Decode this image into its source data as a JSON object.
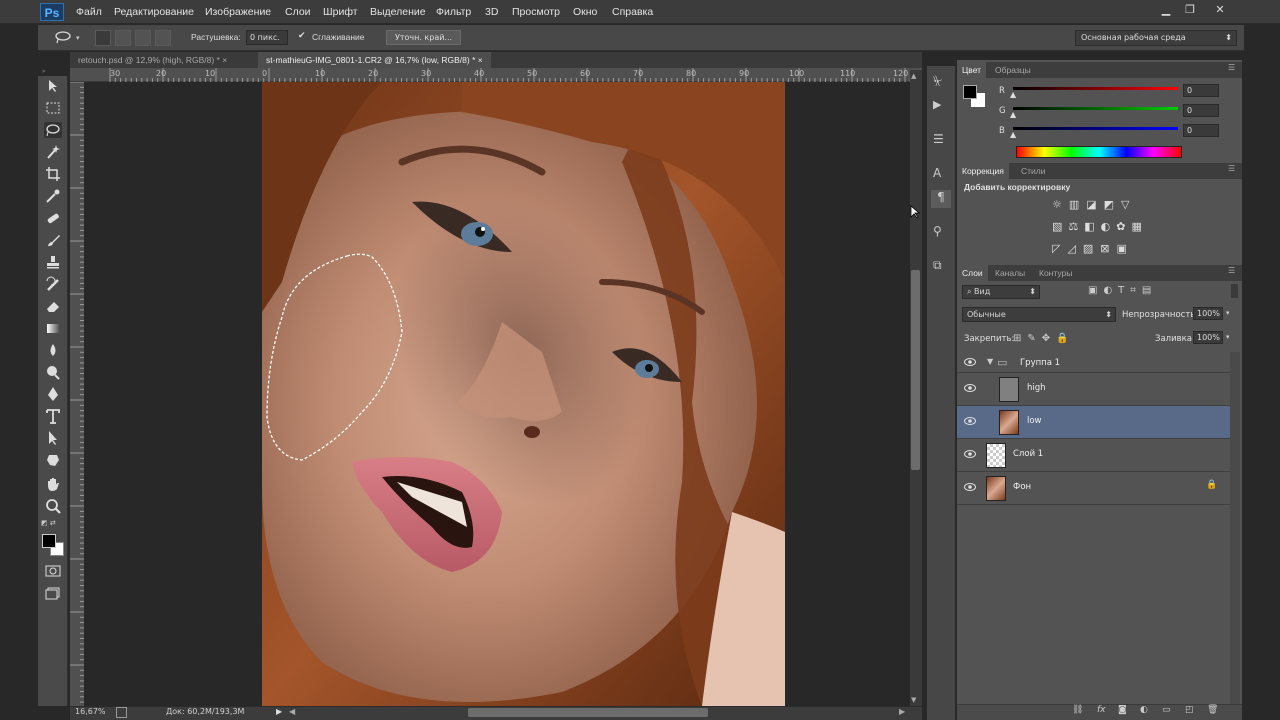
{
  "app": {
    "logo": "Ps"
  },
  "menu": [
    "Файл",
    "Редактирование",
    "Изображение",
    "Слои",
    "Шрифт",
    "Выделение",
    "Фильтр",
    "3D",
    "Просмотр",
    "Окно",
    "Справка"
  ],
  "options": {
    "feather_label": "Растушевка:",
    "feather_value": "0 пикс.",
    "antialias_label": "Сглаживание",
    "refine_edge": "Уточн. край...",
    "workspace": "Основная рабочая среда"
  },
  "tabs": [
    {
      "label": "retouch.psd @ 12,9% (high, RGB/8) *",
      "close": "×"
    },
    {
      "label": "st-mathieuG-IMG_0801-1.CR2 @ 16,7% (low, RGB/8) *",
      "close": "×"
    }
  ],
  "ruler_top": [
    "30",
    "20",
    "10",
    "0",
    "10",
    "20",
    "30",
    "40",
    "50",
    "60",
    "70",
    "80",
    "90",
    "100",
    "110",
    "120"
  ],
  "ruler_left": [
    "5",
    "10",
    "15",
    "20",
    "25",
    "30",
    "35",
    "40",
    "45",
    "50",
    "55",
    "60",
    "65",
    "70"
  ],
  "status": {
    "zoom": "16,67%",
    "doc": "Док: 60,2M/193,3M"
  },
  "color_panel": {
    "tabs": [
      "Цвет",
      "Образцы"
    ],
    "channels": [
      {
        "label": "R",
        "value": "0",
        "color": "#ff0000"
      },
      {
        "label": "G",
        "value": "0",
        "color": "#00cc00"
      },
      {
        "label": "B",
        "value": "0",
        "color": "#0000ff"
      }
    ]
  },
  "adjust_panel": {
    "tabs": [
      "Коррекция",
      "Стили"
    ],
    "title": "Добавить корректировку"
  },
  "layers_panel": {
    "tabs": [
      "Слои",
      "Каналы",
      "Контуры"
    ],
    "kind": "Вид",
    "blend_mode": "Обычные",
    "opacity_label": "Непрозрачность:",
    "opacity_value": "100%",
    "lock_label": "Закрепить:",
    "fill_label": "Заливка:",
    "fill_value": "100%",
    "layers": [
      {
        "name": "Группа 1",
        "type": "group"
      },
      {
        "name": "high",
        "type": "gray"
      },
      {
        "name": "low",
        "type": "photo",
        "selected": true
      },
      {
        "name": "Слой 1",
        "type": "transparent"
      },
      {
        "name": "Фон",
        "type": "photo",
        "locked": true
      }
    ],
    "footer_icons": [
      "link-icon",
      "fx-icon",
      "mask-icon",
      "adjustment-icon",
      "folder-icon",
      "new-layer-icon",
      "trash-icon"
    ]
  },
  "colors": {
    "selected_layer": "#586a88",
    "panel_bg": "#535353",
    "accent": "#57b4ff"
  }
}
